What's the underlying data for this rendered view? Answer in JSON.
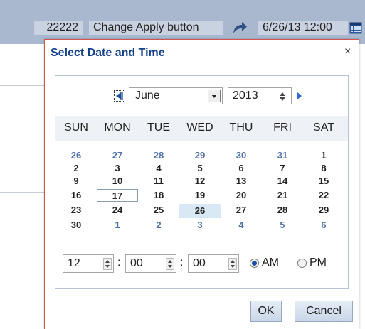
{
  "toolbar": {
    "number": "22222",
    "change_button": "Change Apply button",
    "date_value": "6/26/13 12:00"
  },
  "dialog": {
    "title": "Select Date and Time",
    "close": "×",
    "month": "June",
    "year": "2013",
    "weekdays": [
      "SUN",
      "MON",
      "TUE",
      "WED",
      "THU",
      "FRI",
      "SAT"
    ],
    "weeks": [
      [
        "26",
        "27",
        "28",
        "29",
        "30",
        "31",
        "1"
      ],
      [
        "2",
        "3",
        "4",
        "5",
        "6",
        "7",
        "8"
      ],
      [
        "9",
        "10",
        "11",
        "12",
        "13",
        "14",
        "15"
      ],
      [
        "16",
        "17",
        "18",
        "19",
        "20",
        "21",
        "22"
      ],
      [
        "23",
        "24",
        "25",
        "26",
        "27",
        "28",
        "29"
      ],
      [
        "30",
        "1",
        "2",
        "3",
        "4",
        "5",
        "6"
      ]
    ],
    "today": "17",
    "selected": "26",
    "time": {
      "hour": "12",
      "minute": "00",
      "second": "00",
      "separator": ":",
      "am_label": "AM",
      "pm_label": "PM",
      "meridiem_selected": "AM"
    },
    "ok_label": "OK",
    "cancel_label": "Cancel"
  },
  "colors": {
    "accent": "#15428b",
    "dialog_border": "#d9534f",
    "selected_day": "#d8e8f5",
    "other_month_day": "#4d6fa8"
  },
  "icons": [
    "share-arrow-icon",
    "calendar-icon",
    "prev-month-icon",
    "next-month-icon",
    "dropdown-arrow-icon",
    "spinner-icon",
    "close-icon"
  ]
}
